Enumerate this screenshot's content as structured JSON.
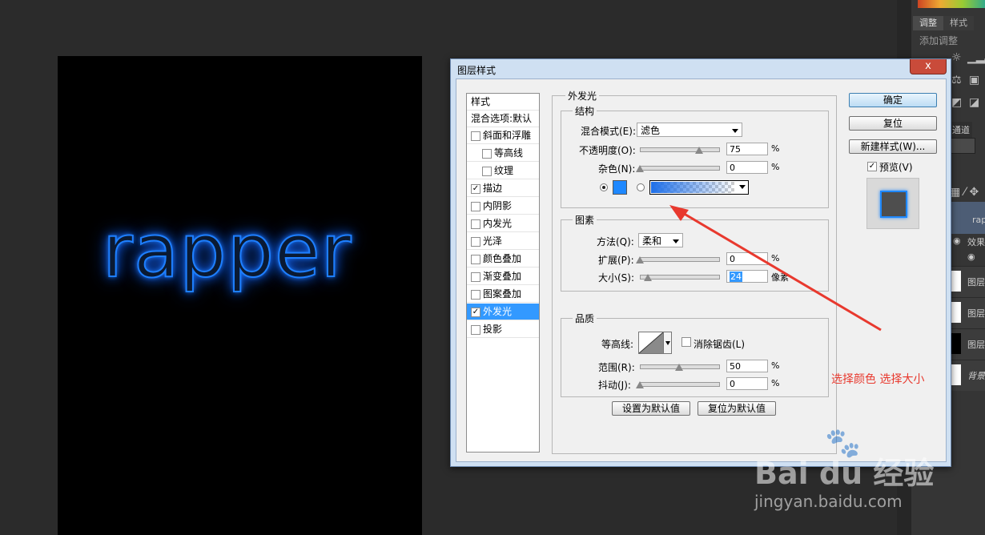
{
  "canvas": {
    "text": "rapper"
  },
  "right_panel": {
    "tabs": [
      "调整",
      "样式"
    ],
    "add_adjustment": "添加调整",
    "channels_tab": "通道",
    "layer_name": "rap",
    "effects_label": "效果",
    "layer_labels": [
      "图层",
      "图层",
      "图层"
    ],
    "background_label": "背景"
  },
  "dialog": {
    "title": "图层样式",
    "close": "x",
    "styles_header": "样式",
    "blend_options": "混合选项:默认",
    "items": [
      {
        "label": "斜面和浮雕",
        "checked": false,
        "indent": false
      },
      {
        "label": "等高线",
        "checked": false,
        "indent": true
      },
      {
        "label": "纹理",
        "checked": false,
        "indent": true
      },
      {
        "label": "描边",
        "checked": true,
        "indent": false
      },
      {
        "label": "内阴影",
        "checked": false,
        "indent": false
      },
      {
        "label": "内发光",
        "checked": false,
        "indent": false
      },
      {
        "label": "光泽",
        "checked": false,
        "indent": false
      },
      {
        "label": "颜色叠加",
        "checked": false,
        "indent": false
      },
      {
        "label": "渐变叠加",
        "checked": false,
        "indent": false
      },
      {
        "label": "图案叠加",
        "checked": false,
        "indent": false
      },
      {
        "label": "外发光",
        "checked": true,
        "indent": false,
        "selected": true
      },
      {
        "label": "投影",
        "checked": false,
        "indent": false
      }
    ],
    "outer_glow": {
      "title": "外发光",
      "structure": {
        "title": "结构",
        "blend_mode_label": "混合模式(E):",
        "blend_mode_value": "滤色",
        "opacity_label": "不透明度(O):",
        "opacity_value": "75",
        "opacity": 0.75,
        "noise_label": "杂色(N):",
        "noise_value": "0",
        "noise": 0,
        "color": "#1e88ff"
      },
      "elements": {
        "title": "图素",
        "technique_label": "方法(Q):",
        "technique_value": "柔和",
        "spread_label": "扩展(P):",
        "spread_value": "0",
        "spread": 0,
        "size_label": "大小(S):",
        "size_value": "24",
        "size_unit": "像素",
        "size": 0.1
      },
      "quality": {
        "title": "品质",
        "contour_label": "等高线:",
        "antialias_label": "消除锯齿(L)",
        "range_label": "范围(R):",
        "range_value": "50",
        "range": 0.5,
        "jitter_label": "抖动(J):",
        "jitter_value": "0",
        "jitter": 0
      },
      "percent": "%",
      "make_default": "设置为默认值",
      "reset_default": "复位为默认值"
    },
    "buttons": {
      "ok": "确定",
      "reset": "复位",
      "new_style": "新建样式(W)...",
      "preview": "预览(V)"
    }
  },
  "annotation": "选择颜色  选择大小",
  "watermark": {
    "brand": "Bai du 经验",
    "url": "jingyan.baidu.com"
  },
  "colors": {
    "glow": "#1e88ff",
    "selection": "#3399ff",
    "annotation": "#e8392e"
  }
}
